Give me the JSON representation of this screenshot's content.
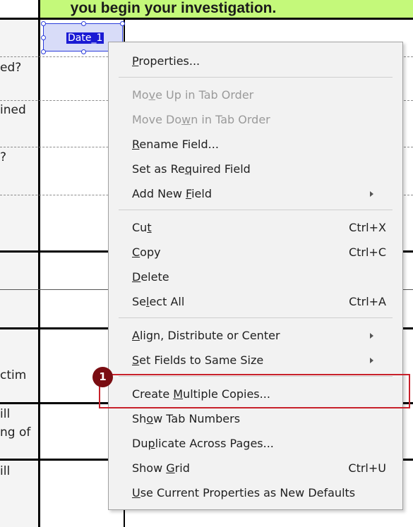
{
  "background": {
    "banner_text": "you begin your investigation.",
    "left_fragments": [
      "ed?",
      "ined",
      "?",
      "ctim",
      "ill",
      "ng of",
      "ill"
    ],
    "banner_color": "#c4f97a"
  },
  "field": {
    "name": "Date_1"
  },
  "context_menu": {
    "items": [
      {
        "label": "Properties...",
        "mnemonic": "P",
        "shortcut": "",
        "disabled": false,
        "submenu": false
      },
      {
        "label": "Move Up in Tab Order",
        "mnemonic": "v",
        "shortcut": "",
        "disabled": true,
        "submenu": false
      },
      {
        "label": "Move Down in Tab Order",
        "mnemonic": "w",
        "shortcut": "",
        "disabled": true,
        "submenu": false
      },
      {
        "label": "Rename Field...",
        "mnemonic": "R",
        "shortcut": "",
        "disabled": false,
        "submenu": false
      },
      {
        "label": "Set as Required Field",
        "mnemonic": "q",
        "shortcut": "",
        "disabled": false,
        "submenu": false
      },
      {
        "label": "Add New Field",
        "mnemonic": "F",
        "shortcut": "",
        "disabled": false,
        "submenu": true
      },
      {
        "label": "Cut",
        "mnemonic": "t",
        "shortcut": "Ctrl+X",
        "disabled": false,
        "submenu": false
      },
      {
        "label": "Copy",
        "mnemonic": "C",
        "shortcut": "Ctrl+C",
        "disabled": false,
        "submenu": false
      },
      {
        "label": "Delete",
        "mnemonic": "D",
        "shortcut": "",
        "disabled": false,
        "submenu": false
      },
      {
        "label": "Select All",
        "mnemonic": "l",
        "shortcut": "Ctrl+A",
        "disabled": false,
        "submenu": false
      },
      {
        "label": "Align, Distribute or Center",
        "mnemonic": "A",
        "shortcut": "",
        "disabled": false,
        "submenu": true
      },
      {
        "label": "Set Fields to Same Size",
        "mnemonic": "S",
        "shortcut": "",
        "disabled": false,
        "submenu": true
      },
      {
        "label": "Create Multiple Copies...",
        "mnemonic": "M",
        "shortcut": "",
        "disabled": false,
        "submenu": false
      },
      {
        "label": "Show Tab Numbers",
        "mnemonic": "o",
        "shortcut": "",
        "disabled": false,
        "submenu": false
      },
      {
        "label": "Duplicate Across Pages...",
        "mnemonic": "p",
        "shortcut": "",
        "disabled": false,
        "submenu": false
      },
      {
        "label": "Show Grid",
        "mnemonic": "G",
        "shortcut": "Ctrl+U",
        "disabled": false,
        "submenu": false
      },
      {
        "label": "Use Current Properties as New Defaults",
        "mnemonic": "U",
        "shortcut": "",
        "disabled": false,
        "submenu": false
      }
    ]
  },
  "annotation": {
    "step_number": "1",
    "highlight_color": "#c8212b",
    "badge_color": "#7a0d12"
  }
}
